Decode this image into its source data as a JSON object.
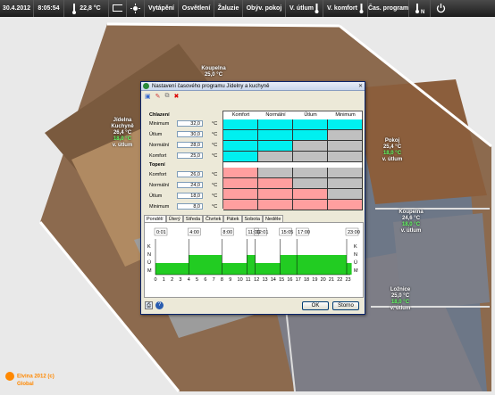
{
  "topbar": {
    "date": "30.4.2012",
    "time": "8:05:54",
    "temperature": "22,8 °C",
    "buttons": [
      "Vytápění",
      "Osvětlení",
      "Žaluzie",
      "Obýv. pokoj",
      "V. útlum",
      "V. komfort",
      "Čas. program"
    ]
  },
  "rooms": [
    {
      "name": "Jídelna\nKuchyně",
      "temp": "26,4 °C",
      "set": "18,0 °C",
      "mode": "v. útlum"
    },
    {
      "name": "Koupelna",
      "temp": "25,0 °C",
      "set": "",
      "mode": ""
    },
    {
      "name": "Pokoj",
      "temp": "25,4 °C",
      "set": "18,0 °C",
      "mode": "v. útlum"
    },
    {
      "name": "Koupelna",
      "temp": "24,6 °C",
      "set": "18,0 °C",
      "mode": "v. útlum"
    },
    {
      "name": "Ložnice",
      "temp": "25,0 °C",
      "set": "18,0 °C",
      "mode": "v. útlum"
    }
  ],
  "logo": {
    "line1": "Elvina 2012 (c)",
    "line2": "Global"
  },
  "dialog": {
    "title": "Nastavení časového programu Jídelny a kuchyně",
    "cooling_label": "Chlazení",
    "heating_label": "Topení",
    "unit": "°C",
    "cooling": [
      {
        "label": "Minimum",
        "value": "32,0"
      },
      {
        "label": "Útlum",
        "value": "30,0"
      },
      {
        "label": "Normální",
        "value": "28,0"
      },
      {
        "label": "Komfort",
        "value": "25,0"
      }
    ],
    "heating": [
      {
        "label": "Komfort",
        "value": "26,0"
      },
      {
        "label": "Normální",
        "value": "24,0"
      },
      {
        "label": "Útlum",
        "value": "18,0"
      },
      {
        "label": "Minimum",
        "value": "8,0"
      }
    ],
    "columns": [
      "Komfort",
      "Normální",
      "Útlum",
      "Minimum"
    ],
    "matrix_colors": {
      "cyan": "#00f0f0",
      "gray": "#c0c0c0",
      "pink": "#ff9f9f",
      "white": "#ffffff"
    },
    "days": [
      "Pondělí",
      "Úterý",
      "Středa",
      "Čtvrtek",
      "Pátek",
      "Sobota",
      "Neděle"
    ],
    "active_day": "Pondělí",
    "levels": [
      "K",
      "N",
      "Ú",
      "M"
    ],
    "hours": [
      "0",
      "1",
      "2",
      "3",
      "4",
      "5",
      "6",
      "7",
      "8",
      "9",
      "10",
      "11",
      "12",
      "13",
      "14",
      "15",
      "16",
      "17",
      "18",
      "19",
      "20",
      "21",
      "22",
      "23"
    ],
    "time_labels": [
      "0:01",
      "4:00",
      "8:00",
      "11:00",
      "12:01",
      "15:05",
      "17:00",
      "23:00"
    ],
    "ok": "OK",
    "cancel": "Storno"
  }
}
